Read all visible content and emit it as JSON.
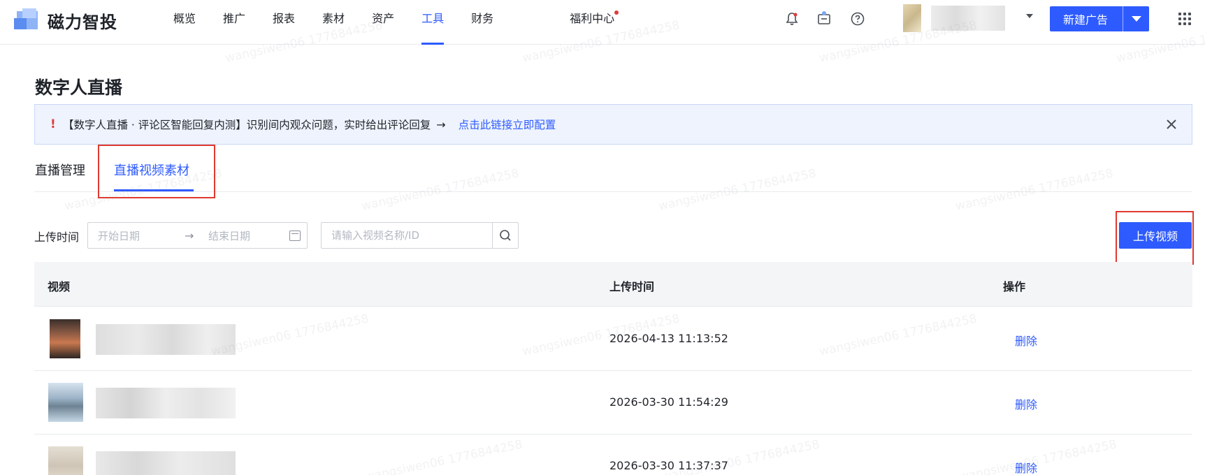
{
  "app": {
    "logo_text": "磁力智投"
  },
  "nav": {
    "items": [
      {
        "label": "概览"
      },
      {
        "label": "推广"
      },
      {
        "label": "报表"
      },
      {
        "label": "素材"
      },
      {
        "label": "资产"
      },
      {
        "label": "工具"
      },
      {
        "label": "财务"
      }
    ],
    "active": "工具",
    "welfare": "福利中心",
    "new_ad_label": "新建广告"
  },
  "page": {
    "title": "数字人直播"
  },
  "banner": {
    "icon": "!",
    "message": "【数字人直播 · 评论区智能回复内测】识别间内观众问题，实时给出评论回复",
    "arrow": "→",
    "link": "点击此链接立即配置"
  },
  "tabs": [
    {
      "label": "直播管理"
    },
    {
      "label": "直播视频素材"
    }
  ],
  "filter": {
    "label": "上传时间",
    "start_placeholder": "开始日期",
    "separator": "→",
    "end_placeholder": "结束日期",
    "search_placeholder": "请输入视频名称/ID",
    "upload_label": "上传视频"
  },
  "table": {
    "columns": [
      "视频",
      "上传时间",
      "操作"
    ],
    "rows": [
      {
        "time": "2026-04-13 11:13:52",
        "action": "删除"
      },
      {
        "time": "2026-03-30 11:54:29",
        "action": "删除"
      },
      {
        "time": "2026-03-30 11:37:37",
        "action": "删除"
      }
    ]
  },
  "watermark": "wangsiwen06 1776844258",
  "colors": {
    "accent": "#2e5bff",
    "highlight_box": "#e0392f",
    "banner_bg": "#eef3fd"
  }
}
